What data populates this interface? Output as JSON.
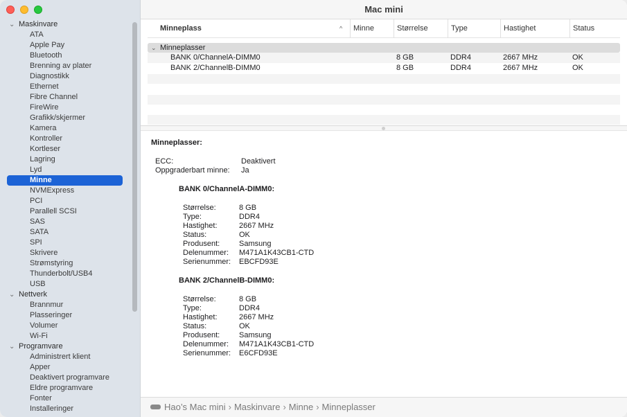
{
  "window": {
    "title": "Mac mini"
  },
  "sidebar": {
    "groups": [
      {
        "label": "Maskinvare",
        "items": [
          "ATA",
          "Apple Pay",
          "Bluetooth",
          "Brenning av plater",
          "Diagnostikk",
          "Ethernet",
          "Fibre Channel",
          "FireWire",
          "Grafikk/skjermer",
          "Kamera",
          "Kontroller",
          "Kortleser",
          "Lagring",
          "Lyd",
          "Minne",
          "NVMExpress",
          "PCI",
          "Parallell SCSI",
          "SAS",
          "SATA",
          "SPI",
          "Skrivere",
          "Strømstyring",
          "Thunderbolt/USB4",
          "USB"
        ]
      },
      {
        "label": "Nettverk",
        "items": [
          "Brannmur",
          "Plasseringer",
          "Volumer",
          "Wi-Fi"
        ]
      },
      {
        "label": "Programvare",
        "items": [
          "Administrert klient",
          "Apper",
          "Deaktivert programvare",
          "Eldre programvare",
          "Fonter",
          "Installeringer"
        ]
      }
    ],
    "selected": "Minne"
  },
  "table": {
    "columns": [
      "Minneplass",
      "Minne",
      "Størrelse",
      "Type",
      "Hastighet",
      "Status"
    ],
    "group_label": "Minneplasser",
    "rows": [
      {
        "slot": "BANK 0/ChannelA-DIMM0",
        "memory": "",
        "size": "8 GB",
        "type": "DDR4",
        "speed": "2667 MHz",
        "status": "OK"
      },
      {
        "slot": "BANK 2/ChannelB-DIMM0",
        "memory": "",
        "size": "8 GB",
        "type": "DDR4",
        "speed": "2667 MHz",
        "status": "OK"
      }
    ]
  },
  "detail": {
    "heading": "Minneplasser:",
    "summary": [
      {
        "key": "ECC:",
        "value": "Deaktivert"
      },
      {
        "key": "Oppgraderbart minne:",
        "value": "Ja"
      }
    ],
    "banks": [
      {
        "title": "BANK 0/ChannelA-DIMM0:",
        "fields": [
          {
            "key": "Størrelse:",
            "value": "8 GB"
          },
          {
            "key": "Type:",
            "value": "DDR4"
          },
          {
            "key": "Hastighet:",
            "value": "2667 MHz"
          },
          {
            "key": "Status:",
            "value": "OK"
          },
          {
            "key": "Produsent:",
            "value": "Samsung"
          },
          {
            "key": "Delenummer:",
            "value": "M471A1K43CB1-CTD"
          },
          {
            "key": "Serienummer:",
            "value": "EBCFD93E"
          }
        ]
      },
      {
        "title": "BANK 2/ChannelB-DIMM0:",
        "fields": [
          {
            "key": "Størrelse:",
            "value": "8 GB"
          },
          {
            "key": "Type:",
            "value": "DDR4"
          },
          {
            "key": "Hastighet:",
            "value": "2667 MHz"
          },
          {
            "key": "Status:",
            "value": "OK"
          },
          {
            "key": "Produsent:",
            "value": "Samsung"
          },
          {
            "key": "Delenummer:",
            "value": "M471A1K43CB1-CTD"
          },
          {
            "key": "Serienummer:",
            "value": "E6CFD93E"
          }
        ]
      }
    ]
  },
  "pathbar": {
    "crumbs": [
      "Hao’s Mac mini",
      "Maskinvare",
      "Minne",
      "Minneplasser"
    ],
    "separator": "›"
  },
  "icons": {
    "mac": "mac-mini-icon",
    "chevron": "chevron-down-icon",
    "sort": "sort-ascending-icon"
  }
}
